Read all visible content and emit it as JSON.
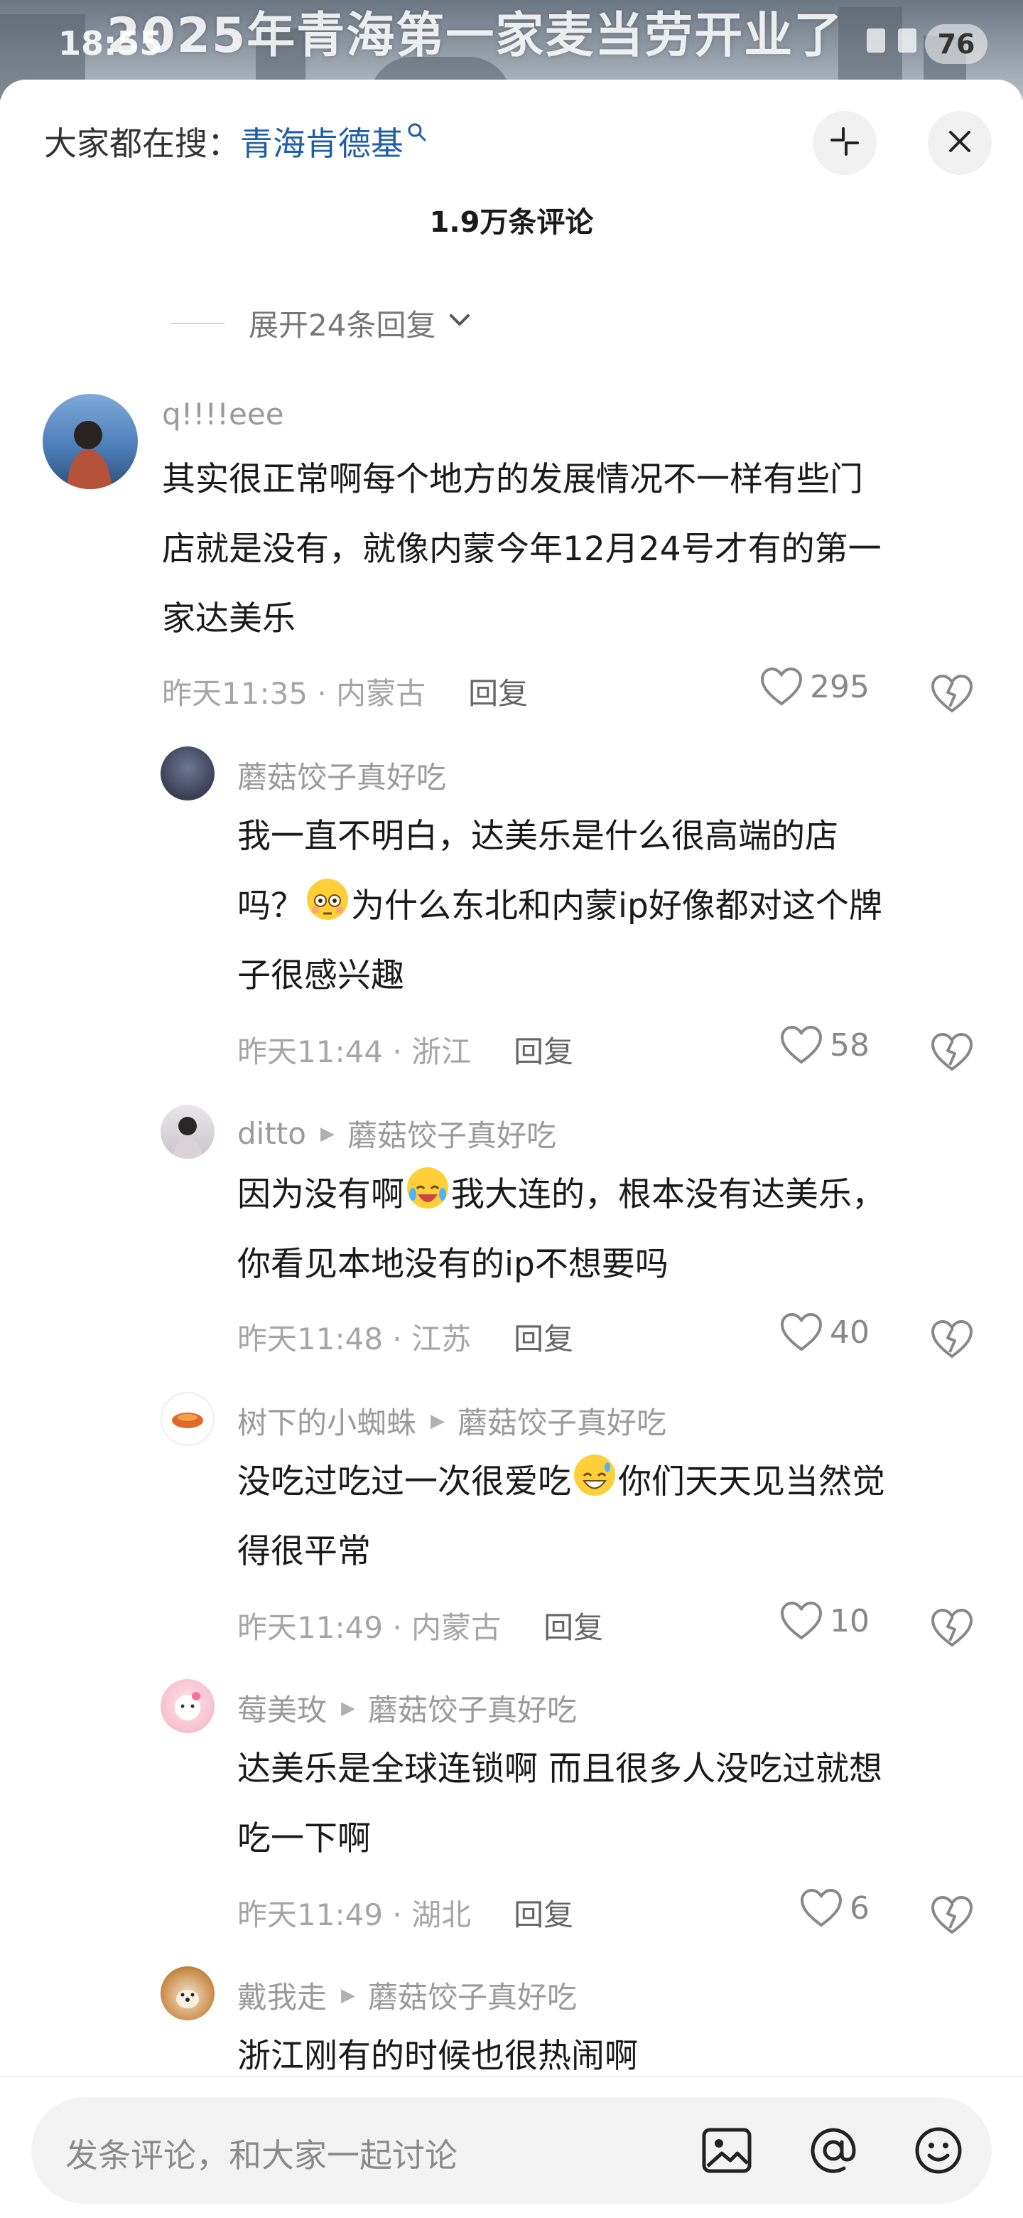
{
  "status_bar": {
    "time": "18:55",
    "battery": "76"
  },
  "video_title": "2025年青海第一家麦当劳开业了",
  "search_hint": {
    "prefix": "大家都在搜：",
    "keyword": "青海肯德基"
  },
  "comments_header": {
    "count_label": "1.9万条评论"
  },
  "expand_replies_label": "展开24条回复",
  "comments": [
    {
      "username": "q!!!!eee",
      "lines": [
        "其实很正常啊每个地方的发展情况不一样有些门",
        "店就是没有，就像内蒙今年12月24号才有的第一",
        "家达美乐"
      ],
      "time_location": "昨天11:35 · 内蒙古",
      "reply_label": "回复",
      "likes": "295"
    },
    {
      "username": "蘑菇饺子真好吃",
      "lines": [
        "我一直不明白，达美乐是什么很高端的店",
        "吗？",
        "为什么东北和内蒙ip好像都对这个牌",
        "子很感兴趣"
      ],
      "time_location": "昨天11:44 · 浙江",
      "reply_label": "回复",
      "likes": "58"
    },
    {
      "username": "ditto",
      "reply_to": "蘑菇饺子真好吃",
      "lines": [
        "因为没有啊",
        "我大连的，根本没有达美乐，",
        "你看见本地没有的ip不想要吗"
      ],
      "time_location": "昨天11:48 · 江苏",
      "reply_label": "回复",
      "likes": "40"
    },
    {
      "username": "树下的小蜘蛛",
      "reply_to": "蘑菇饺子真好吃",
      "lines": [
        "没吃过吃过一次很爱吃",
        "你们天天见当然觉",
        "得很平常"
      ],
      "time_location": "昨天11:49 · 内蒙古",
      "reply_label": "回复",
      "likes": "10"
    },
    {
      "username": "莓美玫",
      "reply_to": "蘑菇饺子真好吃",
      "lines": [
        "达美乐是全球连锁啊 而且很多人没吃过就想",
        "吃一下啊"
      ],
      "time_location": "昨天11:49 · 湖北",
      "reply_label": "回复",
      "likes": "6"
    },
    {
      "username": "戴我走",
      "reply_to": "蘑菇饺子真好吃",
      "lines": [
        "浙江刚有的时候也很热闹啊"
      ]
    }
  ],
  "input_bar": {
    "placeholder": "发条评论，和大家一起讨论"
  },
  "icons": [
    "collapse-icon",
    "close-icon",
    "chevron-down-icon",
    "heart-icon",
    "dislike-heart-icon",
    "image-icon",
    "at-icon",
    "emoji-icon"
  ]
}
